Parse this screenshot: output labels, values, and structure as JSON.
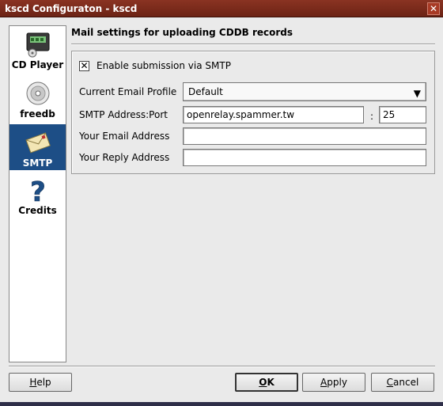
{
  "window": {
    "title": "kscd Configuraton - kscd",
    "close_glyph": "✕"
  },
  "sidebar": {
    "items": [
      {
        "label": "CD Player",
        "icon": "cd-player-icon",
        "active": false
      },
      {
        "label": "freedb",
        "icon": "freedb-disc-icon",
        "active": false
      },
      {
        "label": "SMTP",
        "icon": "envelope-icon",
        "active": true
      },
      {
        "label": "Credits",
        "icon": "question-mark-icon",
        "active": false
      }
    ]
  },
  "main": {
    "section_title": "Mail settings for uploading CDDB records",
    "enable_smtp": {
      "label": "Enable submission via SMTP",
      "checked": true,
      "mark": "✕"
    },
    "profile": {
      "label": "Current Email Profile",
      "value": "Default",
      "arrow": "▼"
    },
    "smtp": {
      "label": "SMTP Address:Port",
      "address": "openrelay.spammer.tw",
      "separator": ":",
      "port": "25"
    },
    "email": {
      "label": "Your Email Address",
      "value": ""
    },
    "reply": {
      "label": "Your Reply Address",
      "value": ""
    }
  },
  "buttons": {
    "help": {
      "mnemonic": "H",
      "rest": "elp"
    },
    "ok": {
      "mnemonic": "O",
      "rest": "K"
    },
    "apply": {
      "mnemonic": "A",
      "rest": "pply"
    },
    "cancel": {
      "mnemonic": "C",
      "rest": "ancel"
    }
  },
  "colors": {
    "titlebar": "#7a2a1a",
    "selection": "#1d4e86",
    "window_bg": "#eaeaea"
  }
}
